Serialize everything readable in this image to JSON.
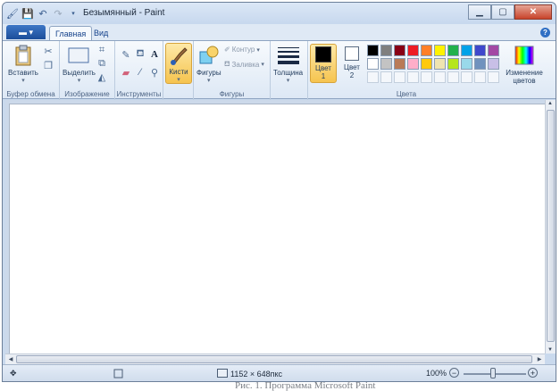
{
  "window": {
    "title": "Безымянный - Paint"
  },
  "tabs": [
    {
      "label": "Главная",
      "active": true
    },
    {
      "label": "Вид",
      "active": false
    }
  ],
  "ribbon": {
    "clipboard": {
      "paste_label": "Вставить",
      "group_label": "Буфер обмена"
    },
    "image": {
      "select_label": "Выделить",
      "group_label": "Изображение"
    },
    "tools": {
      "group_label": "Инструменты"
    },
    "brushes": {
      "label": "Кисти"
    },
    "shapes": {
      "shapes_label": "Фигуры",
      "outline_label": "Контур",
      "fill_label": "Заливка",
      "group_label": "Фигуры"
    },
    "size": {
      "label": "Толщина"
    },
    "colors": {
      "color1_label": "Цвет",
      "color1_num": "1",
      "color2_label": "Цвет",
      "color2_num": "2",
      "edit_label_1": "Изменение",
      "edit_label_2": "цветов",
      "group_label": "Цвета",
      "color1_value": "#000000",
      "color2_value": "#ffffff",
      "palette_row1": [
        "#000000",
        "#7f7f7f",
        "#880015",
        "#ed1c24",
        "#ff7f27",
        "#fff200",
        "#22b14c",
        "#00a2e8",
        "#3f48cc",
        "#a349a4"
      ],
      "palette_row2": [
        "#ffffff",
        "#c3c3c3",
        "#b97a57",
        "#ffaec9",
        "#ffc90e",
        "#efe4b0",
        "#b5e61d",
        "#99d9ea",
        "#7092be",
        "#c8bfe7"
      ]
    }
  },
  "statusbar": {
    "dimensions": "1152 × 648пкс",
    "zoom": "100%"
  },
  "caption": "Рис. 1. Программа Microsoft Paint"
}
